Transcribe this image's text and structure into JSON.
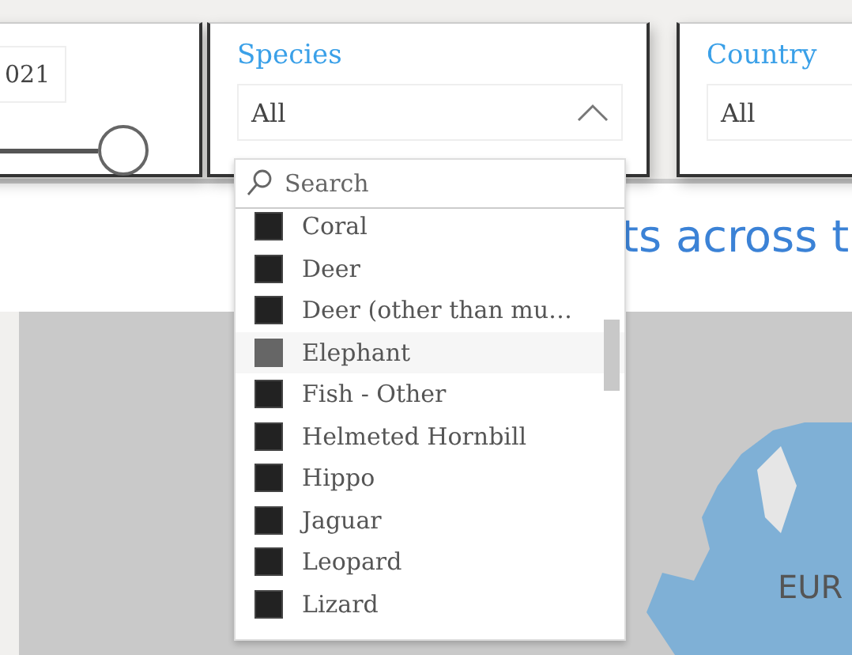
{
  "year_slicer": {
    "value": "021",
    "slider": {
      "level": 1
    }
  },
  "species_slicer": {
    "title": "Species",
    "value": "All",
    "expanded": true,
    "dropdown": {
      "search": {
        "placeholder": "Search"
      },
      "items": [
        {
          "label": "Coral",
          "selected": true,
          "hovered": false
        },
        {
          "label": "Deer",
          "selected": true,
          "hovered": false
        },
        {
          "label": "Deer (other than mu…",
          "selected": true,
          "hovered": false
        },
        {
          "label": "Elephant",
          "selected": true,
          "hovered": true
        },
        {
          "label": "Fish - Other",
          "selected": true,
          "hovered": false
        },
        {
          "label": "Helmeted Hornbill",
          "selected": true,
          "hovered": false
        },
        {
          "label": "Hippo",
          "selected": true,
          "hovered": false
        },
        {
          "label": "Jaguar",
          "selected": true,
          "hovered": false
        },
        {
          "label": "Leopard",
          "selected": true,
          "hovered": false
        },
        {
          "label": "Lizard",
          "selected": true,
          "hovered": false
        }
      ]
    }
  },
  "country_slicer": {
    "title": "Country",
    "value": "All"
  },
  "heading": "ts across t",
  "map": {
    "label": "EUR"
  }
}
